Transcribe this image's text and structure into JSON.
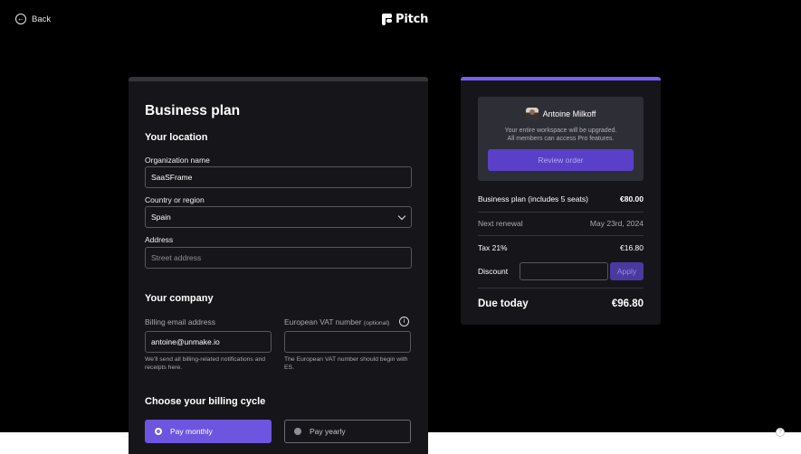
{
  "topbar": {
    "back_label": "Back",
    "brand_name": "Pitch"
  },
  "form": {
    "title": "Business plan",
    "location": {
      "heading": "Your location",
      "org_label": "Organization name",
      "org_value": "SaaSFrame",
      "country_label": "Country or region",
      "country_value": "Spain",
      "address_label": "Address",
      "address_placeholder": "Street address"
    },
    "company": {
      "heading": "Your company",
      "billing_email_label": "Billing email address",
      "billing_email_value": "antoine@unmake.io",
      "billing_email_hint": "We'll send all billing-related notifications and receipts here.",
      "vat_label": "European VAT number",
      "vat_optional": "(optional)",
      "vat_value": "",
      "vat_hint": "The European VAT number should begin with ES."
    },
    "billing_cycle": {
      "heading": "Choose your billing cycle",
      "monthly_label": "Pay monthly",
      "yearly_label": "Pay yearly",
      "selected": "monthly"
    }
  },
  "summary": {
    "user_name": "Antoine Milkoff",
    "upgrade_note_line1": "Your entire workspace will be upgraded.",
    "upgrade_note_line2": "All members can access Pro features.",
    "review_button": "Review order",
    "plan_label": "Business plan (includes 5 seats)",
    "plan_price": "€80.00",
    "renewal_label": "Next renewal",
    "renewal_date": "May 23rd, 2024",
    "tax_label": "Tax 21%",
    "tax_amount": "€16.80",
    "discount_label": "Discount",
    "discount_value": "",
    "apply_button": "Apply",
    "due_label": "Due today",
    "due_amount": "€96.80"
  },
  "colors": {
    "accent": "#6e55e0",
    "background": "#000000",
    "panel": "#16161a"
  }
}
